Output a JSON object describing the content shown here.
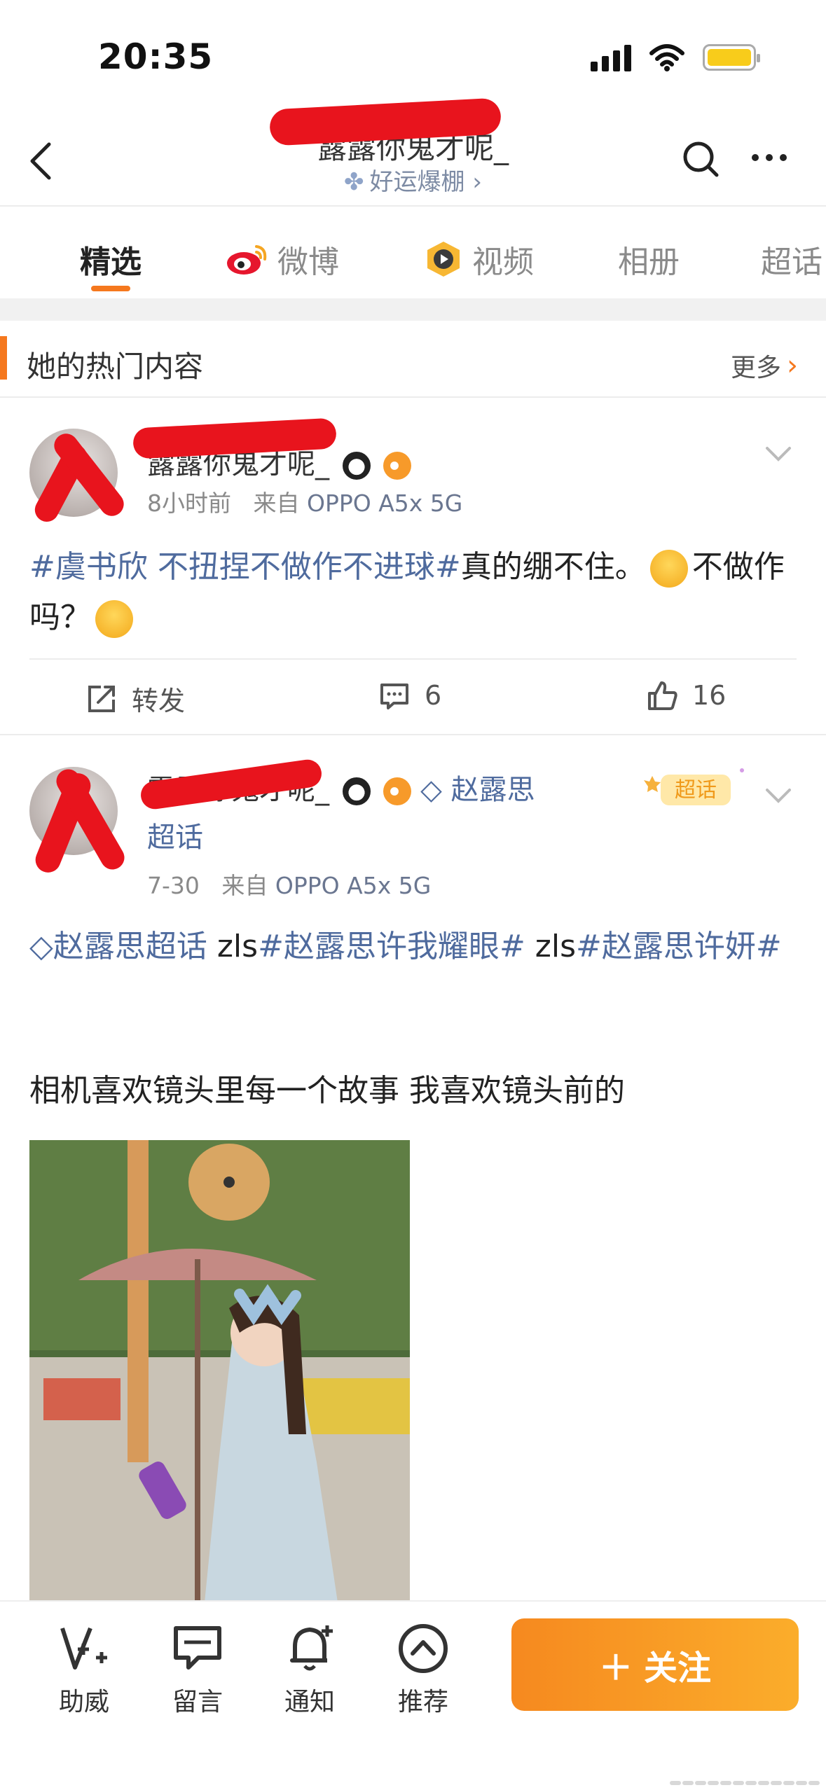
{
  "status_bar": {
    "time": "20:35"
  },
  "nav": {
    "title": "露露你鬼才呢_",
    "subtitle": "好运爆棚 ›",
    "icons": [
      "back-icon",
      "search-icon",
      "more-icon"
    ]
  },
  "tabs": [
    {
      "label": "精选",
      "active": true
    },
    {
      "label": "微博",
      "active": false
    },
    {
      "label": "视频",
      "active": false
    },
    {
      "label": "相册",
      "active": false
    },
    {
      "label": "超话",
      "active": false
    }
  ],
  "section": {
    "title": "她的热门内容",
    "more": "更多"
  },
  "post1": {
    "username": "露露你鬼才呢_",
    "time": "8小时前",
    "source_prefix": "来自",
    "device": "OPPO A5x 5G",
    "topic": "#虞书欣 不扭捏不做作不进球#",
    "text_a": "真的绷不住。",
    "text_b": "不做作吗？",
    "repost_label": "转发",
    "comment_count": "6",
    "like_count": "16"
  },
  "post2": {
    "username": "露露你鬼才呢_",
    "super_topic": "赵露思超话",
    "badge": "超话",
    "date": "7-30",
    "source_prefix": "来自",
    "device": "OPPO A5x 5G",
    "line1_topic1": "赵露思超话",
    "line1_plain1": " zls",
    "line1_topic2": "#赵露思许我耀眼#",
    "line1_plain2": " zls",
    "line1_topic3": "#赵露思许妍#",
    "caption": "相机喜欢镜头里每一个故事 我喜欢镜头前的"
  },
  "bottom_bar": {
    "items": [
      {
        "label": "助威",
        "icon": "v-plus-icon"
      },
      {
        "label": "留言",
        "icon": "chat-icon"
      },
      {
        "label": "通知",
        "icon": "bell-icon"
      },
      {
        "label": "推荐",
        "icon": "chevron-up-circle-icon"
      }
    ],
    "follow": "关注"
  },
  "colors": {
    "accent": "#f5781e",
    "topic": "#4f6b9e",
    "redaction": "#e8141d"
  }
}
